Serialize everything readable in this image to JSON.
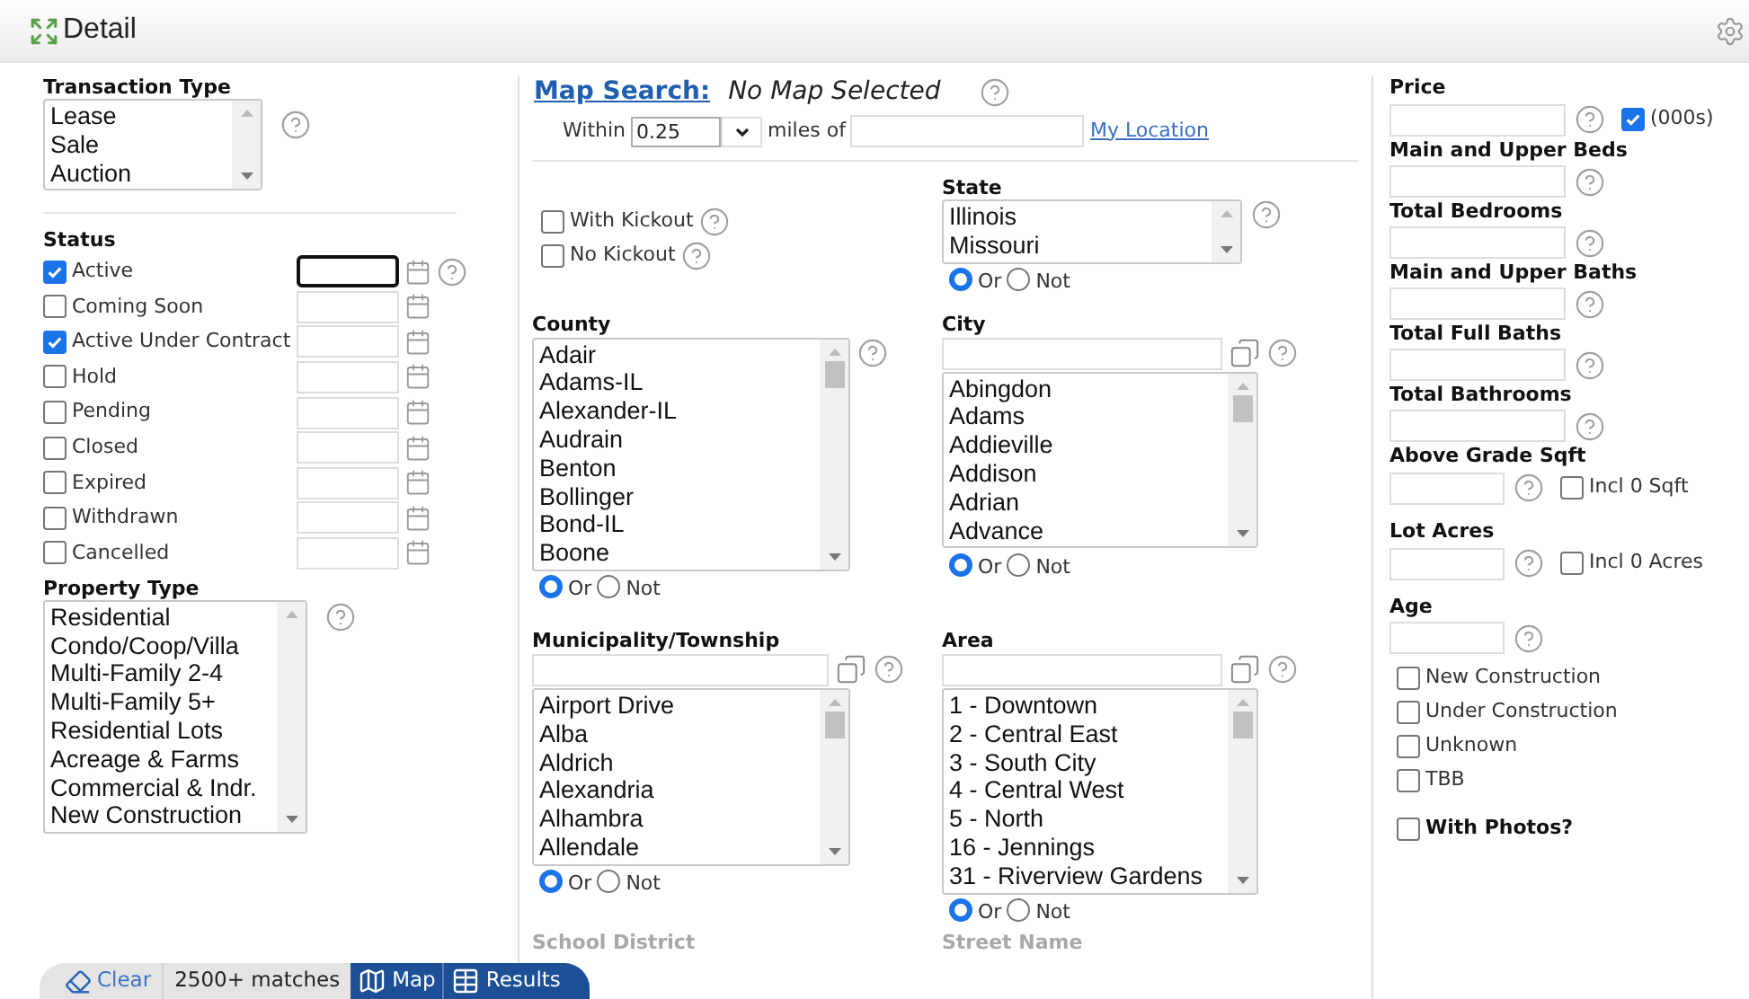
{
  "header": {
    "title": "Detail"
  },
  "transaction_type": {
    "label": "Transaction Type",
    "options": [
      "Lease",
      "Sale",
      "Auction"
    ]
  },
  "status": {
    "label": "Status",
    "items": [
      {
        "label": "Active",
        "checked": true
      },
      {
        "label": "Coming Soon",
        "checked": false
      },
      {
        "label": "Active Under Contract",
        "checked": true
      },
      {
        "label": "Hold",
        "checked": false
      },
      {
        "label": "Pending",
        "checked": false
      },
      {
        "label": "Closed",
        "checked": false
      },
      {
        "label": "Expired",
        "checked": false
      },
      {
        "label": "Withdrawn",
        "checked": false
      },
      {
        "label": "Cancelled",
        "checked": false
      }
    ]
  },
  "property_type": {
    "label": "Property Type",
    "options": [
      "Residential",
      "Condo/Coop/Villa",
      "Multi-Family 2-4",
      "Multi-Family 5+",
      "Residential Lots",
      "Acreage & Farms",
      "Commercial & Indr.",
      "New Construction"
    ]
  },
  "map_search": {
    "link": "Map Search:",
    "status": "No Map Selected",
    "within_label": "Within",
    "radius": "0.25",
    "miles_label": "miles of",
    "location_link": "My Location"
  },
  "kickout": [
    {
      "label": "With Kickout",
      "checked": false
    },
    {
      "label": "No Kickout",
      "checked": false
    }
  ],
  "state": {
    "label": "State",
    "options": [
      "Illinois",
      "Missouri"
    ],
    "modes": [
      {
        "label": "Or",
        "selected": true
      },
      {
        "label": "Not",
        "selected": false
      }
    ]
  },
  "county": {
    "label": "County",
    "options": [
      "Adair",
      "Adams-IL",
      "Alexander-IL",
      "Audrain",
      "Benton",
      "Bollinger",
      "Bond-IL",
      "Boone"
    ],
    "modes": [
      {
        "label": "Or",
        "selected": true
      },
      {
        "label": "Not",
        "selected": false
      }
    ]
  },
  "city": {
    "label": "City",
    "options": [
      "Abingdon",
      "Adams",
      "Addieville",
      "Addison",
      "Adrian",
      "Advance"
    ],
    "modes": [
      {
        "label": "Or",
        "selected": true
      },
      {
        "label": "Not",
        "selected": false
      }
    ]
  },
  "municipality": {
    "label": "Municipality/Township",
    "options": [
      "Airport Drive",
      "Alba",
      "Aldrich",
      "Alexandria",
      "Alhambra",
      "Allendale"
    ],
    "modes": [
      {
        "label": "Or",
        "selected": true
      },
      {
        "label": "Not",
        "selected": false
      }
    ]
  },
  "area": {
    "label": "Area",
    "options": [
      "1 - Downtown",
      "2 - Central East",
      "3 - South City",
      "4 - Central West",
      "5 - North",
      "16 - Jennings",
      "31 - Riverview Gardens"
    ],
    "modes": [
      {
        "label": "Or",
        "selected": true
      },
      {
        "label": "Not",
        "selected": false
      }
    ]
  },
  "faded_labels": [
    "School District",
    "Street Name"
  ],
  "right_fields": [
    {
      "label": "Price",
      "kind": "wide",
      "option": {
        "label": "(000s)",
        "checked": true
      }
    },
    {
      "label": "Main and Upper Beds",
      "kind": "wide"
    },
    {
      "label": "Total Bedrooms",
      "kind": "wide"
    },
    {
      "label": "Main and Upper Baths",
      "kind": "wide"
    },
    {
      "label": "Total Full Baths",
      "kind": "wide"
    },
    {
      "label": "Total Bathrooms",
      "kind": "wide"
    },
    {
      "label": "Above Grade Sqft",
      "kind": "narrow",
      "option": {
        "label": "Incl 0 Sqft",
        "checked": false
      }
    },
    {
      "label": "Lot Acres",
      "kind": "narrow",
      "option": {
        "label": "Incl 0 Acres",
        "checked": false
      }
    },
    {
      "label": "Age",
      "kind": "narrow"
    }
  ],
  "age_options": [
    {
      "label": "New Construction",
      "checked": false
    },
    {
      "label": "Under Construction",
      "checked": false
    },
    {
      "label": "Unknown",
      "checked": false
    },
    {
      "label": "TBB",
      "checked": false
    }
  ],
  "with_photos": {
    "label": "With Photos?",
    "checked": false
  },
  "bottom_bar": {
    "clear": "Clear",
    "matches": "2500+ matches",
    "map": "Map",
    "results": "Results"
  }
}
